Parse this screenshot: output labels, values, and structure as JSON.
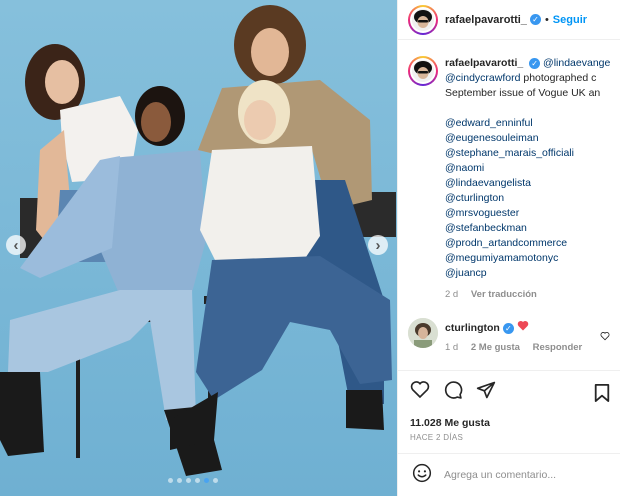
{
  "post": {
    "username": "rafaelpavarotti_",
    "follow_label": "Seguir",
    "separator": "•"
  },
  "caption": {
    "username": "rafaelpavarotti_",
    "first_mention": "@lindaevange",
    "line2_mention": "@cindycrawford",
    "line2_text": " photographed c",
    "line3": "September issue of Vogue UK an",
    "mentions": [
      "@edward_enninful",
      "@eugenesouleiman",
      "@stephane_marais_officiali",
      "@naomi",
      "@lindaevangelista",
      "@cturlington",
      "@mrsvoguester",
      "@stefanbeckman",
      "@prodn_artandcommerce",
      "@megumiyamamotonyc",
      "@juancp"
    ],
    "age": "2 d",
    "translate": "Ver traducción"
  },
  "comment": {
    "username": "cturlington",
    "age": "1 d",
    "likes": "2 Me gusta",
    "reply": "Responder"
  },
  "actions": {
    "likes_count": "11.028 Me gusta",
    "posted_ago": "HACE 2 DÍAS"
  },
  "composer": {
    "placeholder": "Agrega un comentario..."
  },
  "carousel": {
    "slide_count": 6,
    "active_index": 4
  },
  "colors": {
    "photo_background": "#79b7d6",
    "accent": "#0095f6",
    "mention": "#00376b",
    "heart": "#ed4956"
  }
}
